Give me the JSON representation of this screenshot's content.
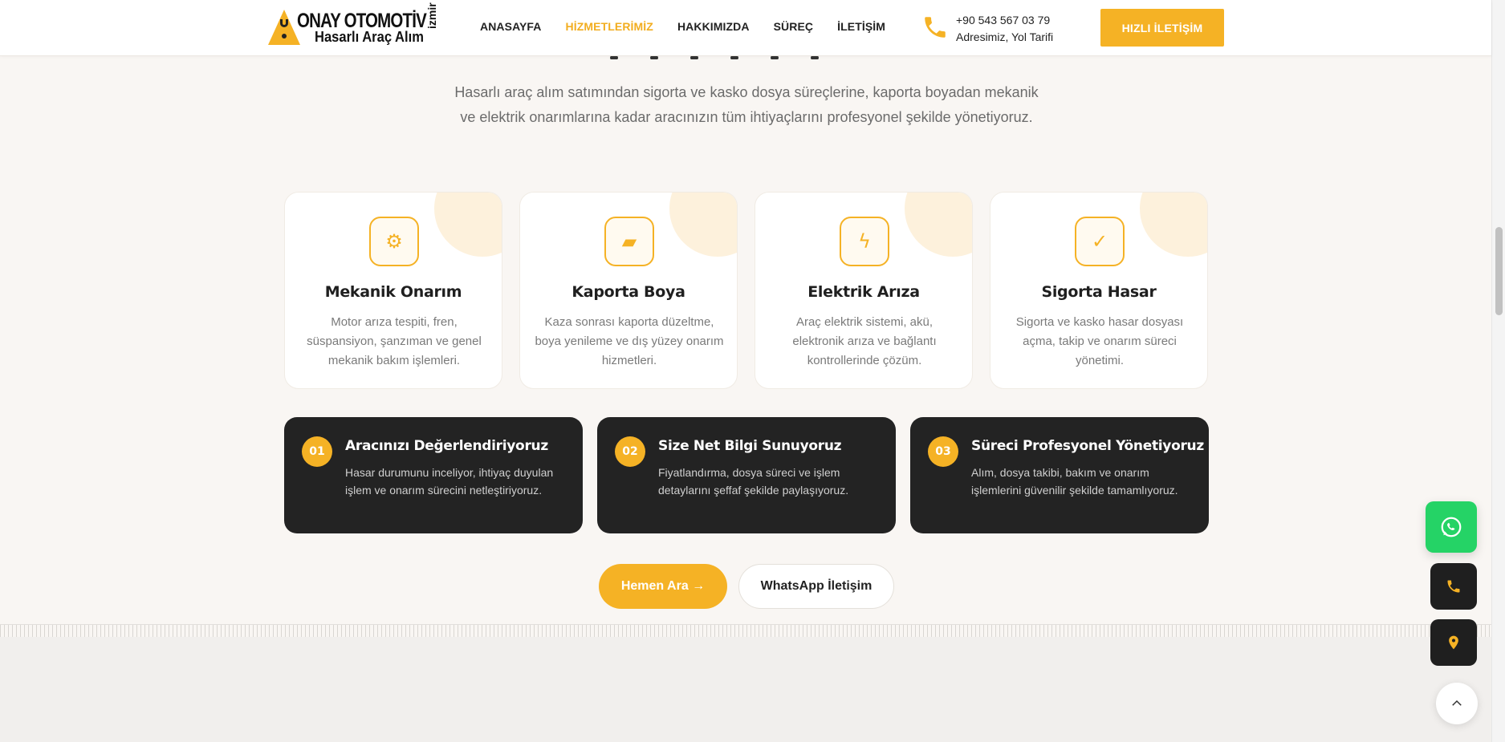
{
  "header": {
    "logo_title": "ONAY OTOMOTİV",
    "logo_subtitle": "Hasarlı Araç Alım",
    "logo_city": "izmir",
    "nav": [
      {
        "label": "ANASAYFA"
      },
      {
        "label": "HİZMETLERİMİZ",
        "active": true
      },
      {
        "label": "HAKKIMIZDA"
      },
      {
        "label": "SÜREÇ"
      },
      {
        "label": "İLETİŞİM"
      }
    ],
    "phone": "+90 543 567 03 79",
    "address_link": "Adresimiz, Yol Tarifi",
    "cta_label": "HIZLI İLETİŞİM",
    "accent_color": "#f5b225"
  },
  "intro": "Hasarlı araç alım satımından sigorta ve kasko dosya süreçlerine, kaporta boyadan mekanik ve elektrik onarımlarına kadar aracınızın tüm ihtiyaçlarını profesyonel şekilde yönetiyoruz.",
  "services": [
    {
      "icon": "gear-icon",
      "glyph": "⚙",
      "title": "Mekanik Onarım",
      "desc": "Motor arıza tespiti, fren, süspansiyon, şanzıman ve genel mekanik bakım işlemleri."
    },
    {
      "icon": "paint-panel-icon",
      "glyph": "▰",
      "title": "Kaporta Boya",
      "desc": "Kaza sonrası kaporta düzeltme, boya yenileme ve dış yüzey onarım hizmetleri."
    },
    {
      "icon": "lightning-icon",
      "glyph": "ϟ",
      "title": "Elektrik Arıza",
      "desc": "Araç elektrik sistemi, akü, elektronik arıza ve bağlantı kontrollerinde çözüm."
    },
    {
      "icon": "check-icon",
      "glyph": "✓",
      "title": "Sigorta Hasar",
      "desc": "Sigorta ve kasko hasar dosyası açma, takip ve onarım süreci yönetimi."
    }
  ],
  "steps": [
    {
      "num": "01",
      "title": "Aracınızı Değerlendiriyoruz",
      "desc": "Hasar durumunu inceliyor, ihtiyaç duyulan işlem ve onarım sürecini netleştiriyoruz."
    },
    {
      "num": "02",
      "title": "Size Net Bilgi Sunuyoruz",
      "desc": "Fiyatlandırma, dosya süreci ve işlem detaylarını şeffaf şekilde paylaşıyoruz."
    },
    {
      "num": "03",
      "title": "Süreci Profesyonel Yönetiyoruz",
      "desc": "Alım, dosya takibi, bakım ve onarım işlemlerini güvenilir şekilde tamamlıyoruz."
    }
  ],
  "actions": {
    "call_label": "Hemen Ara →",
    "whatsapp_label": "WhatsApp İletişim"
  },
  "floating": {
    "whatsapp_icon": "whatsapp-icon",
    "phone_icon": "phone-icon",
    "location_icon": "location-pin-icon",
    "top_icon": "chevron-up-icon"
  }
}
